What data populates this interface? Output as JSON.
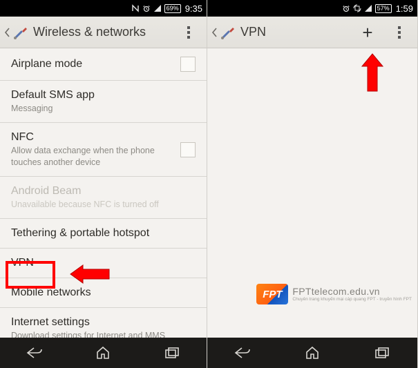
{
  "left": {
    "status": {
      "battery": "69%",
      "time": "9:35"
    },
    "actionbar": {
      "title": "Wireless & networks"
    },
    "rows": {
      "airplane": {
        "title": "Airplane mode"
      },
      "sms": {
        "title": "Default SMS app",
        "sub": "Messaging"
      },
      "nfc": {
        "title": "NFC",
        "sub": "Allow data exchange when the phone touches another device"
      },
      "beam": {
        "title": "Android Beam",
        "sub": "Unavailable because NFC is turned off"
      },
      "tether": {
        "title": "Tethering & portable hotspot"
      },
      "vpn": {
        "title": "VPN"
      },
      "mobile": {
        "title": "Mobile networks"
      },
      "internet": {
        "title": "Internet settings",
        "sub": "Download settings for Internet and MMS"
      }
    }
  },
  "right": {
    "status": {
      "battery": "57%",
      "time": "1:59"
    },
    "actionbar": {
      "title": "VPN"
    },
    "watermark": {
      "logo": "FPT",
      "main": "FPTtelecom.edu.vn",
      "sub": "Chuyên trang khuyến mại cáp quang FPT - truyền hình FPT"
    }
  }
}
